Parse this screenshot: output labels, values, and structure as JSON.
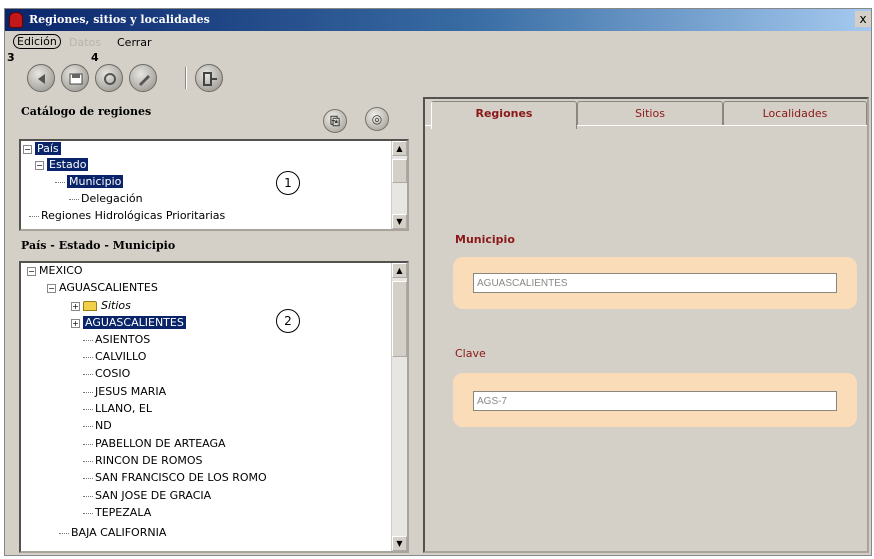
{
  "window": {
    "title": "Regiones, sitios y localidades",
    "close_glyph": "x"
  },
  "menu": {
    "items": [
      {
        "label": "Edición",
        "state": "active"
      },
      {
        "label": "Datos",
        "state": "disabled"
      },
      {
        "label": "Cerrar",
        "state": "normal"
      }
    ]
  },
  "toolbar": {
    "callouts": [
      "3",
      "4"
    ],
    "buttons": [
      {
        "icon": "back-icon"
      },
      {
        "icon": "save-icon"
      },
      {
        "icon": "refresh-icon"
      },
      {
        "icon": "edit-icon"
      },
      {
        "icon": "exit-icon"
      }
    ]
  },
  "catalog": {
    "title": "Catálogo de regiones",
    "button_glyphs": [
      "⎘",
      "◎"
    ],
    "callout": "1",
    "items": [
      {
        "label": "País",
        "selected": true,
        "expander": "−"
      },
      {
        "label": "Estado",
        "selected": true,
        "expander": "−"
      },
      {
        "label": "Municipio",
        "selected": true
      },
      {
        "label": "Delegación",
        "selected": false
      },
      {
        "label": "Regiones Hidrológicas Prioritarias",
        "selected": false
      }
    ]
  },
  "hierarchy": {
    "title": "País - Estado - Municipio",
    "callout": "2",
    "items": [
      {
        "label": "MEXICO",
        "expander": "−"
      },
      {
        "label": "AGUASCALIENTES",
        "expander": "−"
      },
      {
        "label": "Sitios",
        "expander": "+"
      },
      {
        "label": "AGUASCALIENTES",
        "expander": "+",
        "selected": true
      },
      {
        "label": "ASIENTOS"
      },
      {
        "label": "CALVILLO"
      },
      {
        "label": "COSIO"
      },
      {
        "label": "JESUS MARIA"
      },
      {
        "label": "LLANO, EL"
      },
      {
        "label": "ND"
      },
      {
        "label": "PABELLON DE ARTEAGA"
      },
      {
        "label": "RINCON DE ROMOS"
      },
      {
        "label": "SAN FRANCISCO DE LOS ROMO"
      },
      {
        "label": "SAN JOSE DE GRACIA"
      },
      {
        "label": "TEPEZALA"
      },
      {
        "label": "BAJA CALIFORNIA"
      }
    ]
  },
  "tabs": [
    {
      "label": "Regiones",
      "active": true
    },
    {
      "label": "Sitios",
      "active": false
    },
    {
      "label": "Localidades",
      "active": false
    }
  ],
  "form": {
    "municipio_label": "Municipio",
    "municipio_value": "AGUASCALIENTES",
    "clave_label": "Clave",
    "clave_value": "AGS-7"
  },
  "scrollbar": {
    "up_arrow": "▲",
    "down_arrow": "▼"
  },
  "colors": {
    "selection": "#0a246a",
    "label_red": "#8a1818",
    "field_bg": "#fbdcb8"
  }
}
